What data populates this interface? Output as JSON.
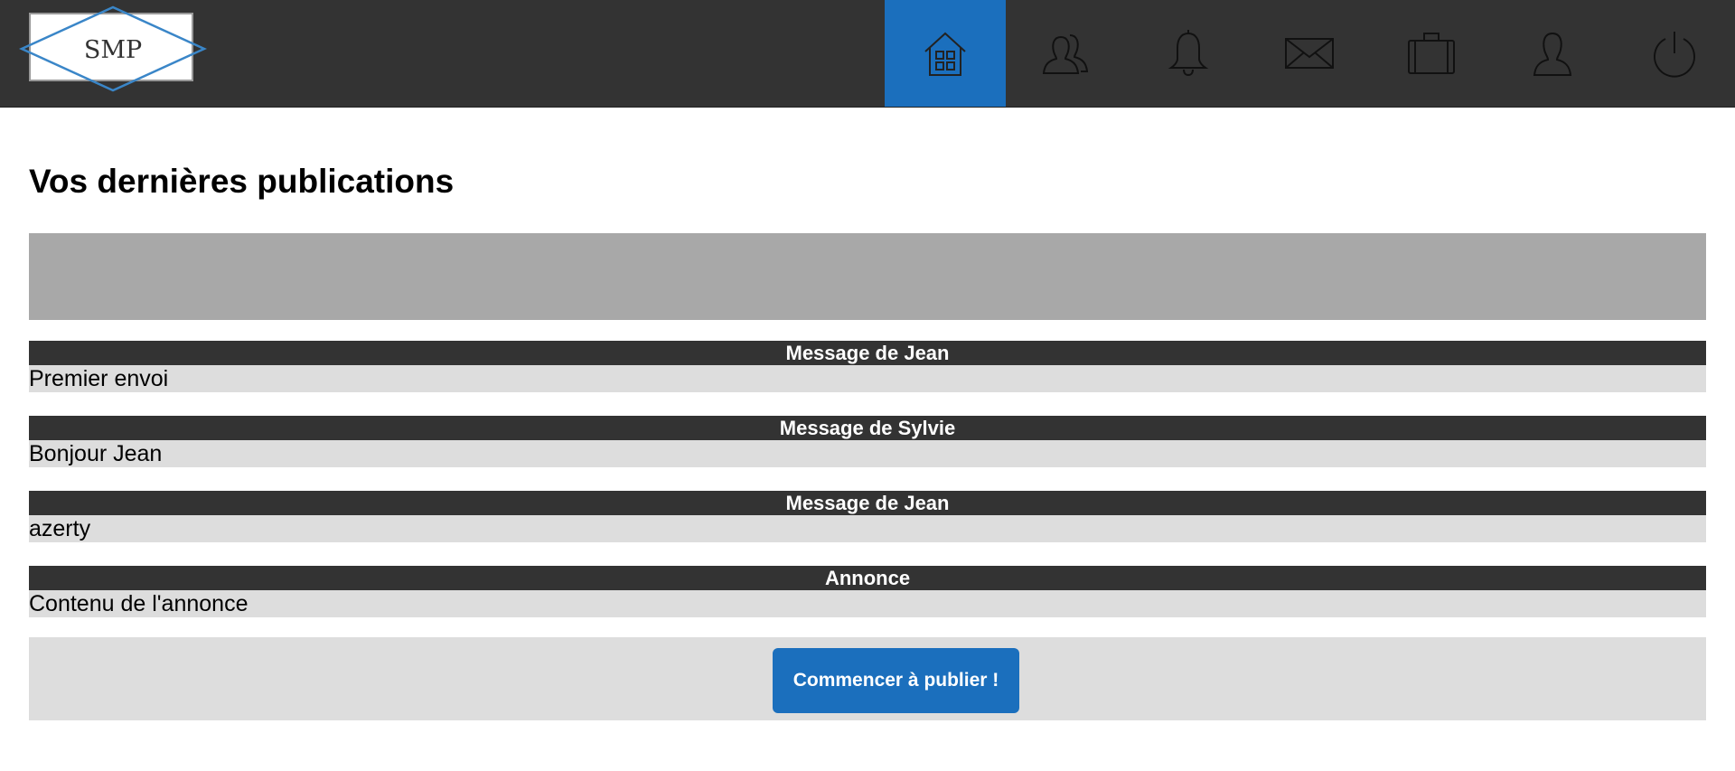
{
  "header": {
    "logo_text": "SMP",
    "nav": [
      {
        "name": "home",
        "active": true
      },
      {
        "name": "friends",
        "active": false
      },
      {
        "name": "notifications",
        "active": false
      },
      {
        "name": "messages",
        "active": false
      },
      {
        "name": "jobs",
        "active": false
      },
      {
        "name": "profile",
        "active": false
      },
      {
        "name": "logout",
        "active": false
      }
    ],
    "colors": {
      "bar": "#333333",
      "active": "#1b6fbd"
    }
  },
  "main": {
    "title": "Vos dernières publications",
    "posts": [
      {
        "header": "Message de Jean",
        "body": "Premier envoi"
      },
      {
        "header": "Message de Sylvie",
        "body": "Bonjour Jean"
      },
      {
        "header": "Message de Jean",
        "body": "azerty"
      },
      {
        "header": "Annonce",
        "body": "Contenu de l'annonce"
      }
    ],
    "cta_label": "Commencer à publier !"
  }
}
